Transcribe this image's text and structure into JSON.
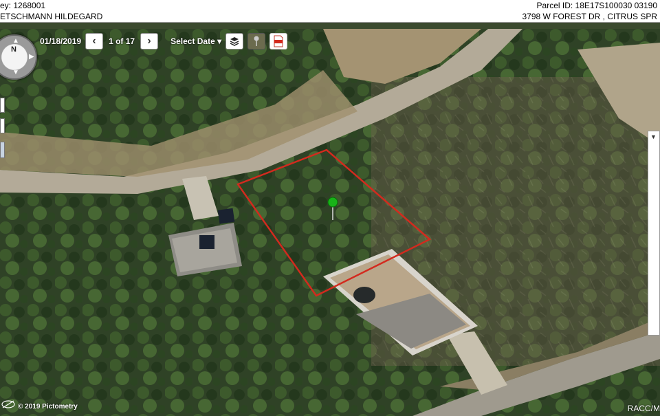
{
  "header": {
    "left_line1": "ey: 1268001",
    "right_line1": "Parcel ID: 18E17S100030 03190",
    "left_line2": "ETSCHMANN HILDEGARD",
    "right_line2": "3798 W FOREST DR , CITRUS SPR"
  },
  "toolbar": {
    "date": "01/18/2019",
    "prev_icon": "chevron-left-icon",
    "page_count": "1 of 17",
    "next_icon": "chevron-right-icon",
    "select_date_label": "Select Date",
    "layers_icon": "layers-icon",
    "measure_icon": "pushpin-icon",
    "pdf_icon": "pdf-icon"
  },
  "compass": {
    "north_label": "N"
  },
  "map": {
    "copyright": "© 2019 Pictometry",
    "watermark": "RACC/M",
    "parcel_outline_color": "#d32a1e",
    "marker_color": "#18b318"
  }
}
